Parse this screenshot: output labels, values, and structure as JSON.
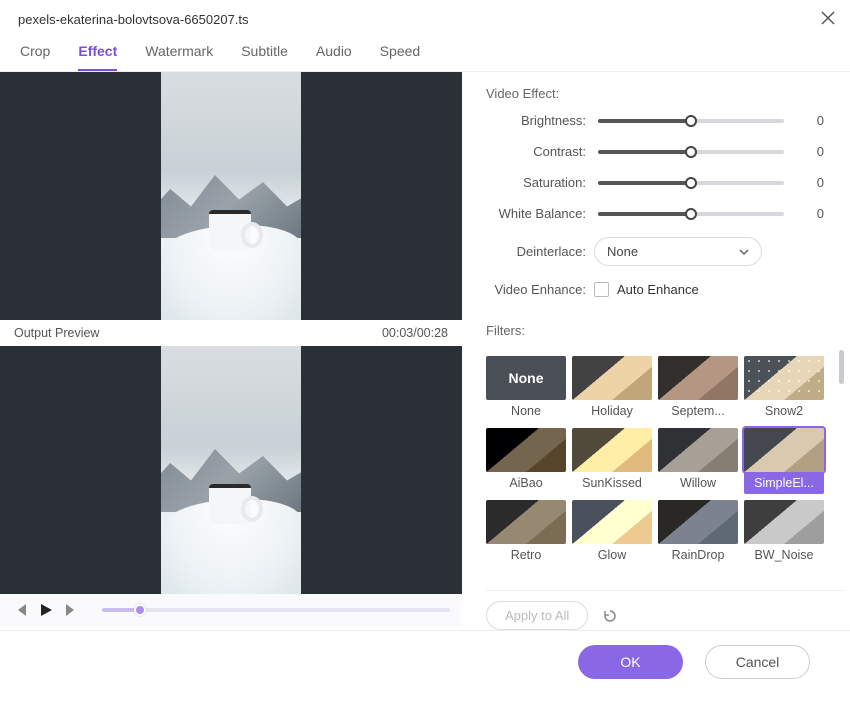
{
  "title": "pexels-ekaterina-bolovtsova-6650207.ts",
  "tabs": [
    "Crop",
    "Effect",
    "Watermark",
    "Subtitle",
    "Audio",
    "Speed"
  ],
  "active_tab": 1,
  "preview": {
    "label": "Output Preview",
    "time": "00:03/00:28",
    "seek_pct": 11
  },
  "video_effect": {
    "title": "Video Effect:",
    "params": [
      {
        "label": "Brightness:",
        "value": "0",
        "pct": 50
      },
      {
        "label": "Contrast:",
        "value": "0",
        "pct": 50
      },
      {
        "label": "Saturation:",
        "value": "0",
        "pct": 50
      },
      {
        "label": "White Balance:",
        "value": "0",
        "pct": 50
      }
    ],
    "deinterlace": {
      "label": "Deinterlace:",
      "selected": "None"
    },
    "enhance": {
      "label": "Video Enhance:",
      "option": "Auto Enhance"
    }
  },
  "filters": {
    "title": "Filters:",
    "items": [
      {
        "label": "None",
        "cls": "none",
        "is_none": true
      },
      {
        "label": "Holiday",
        "cls": "t-holiday"
      },
      {
        "label": "Septem...",
        "cls": "t-septem"
      },
      {
        "label": "Snow2",
        "cls": "t-snow2"
      },
      {
        "label": "AiBao",
        "cls": "t-aibao"
      },
      {
        "label": "SunKissed",
        "cls": "t-sunk"
      },
      {
        "label": "Willow",
        "cls": "t-willow"
      },
      {
        "label": "SimpleEl...",
        "cls": "t-simple",
        "selected": true
      },
      {
        "label": "Retro",
        "cls": "t-retro"
      },
      {
        "label": "Glow",
        "cls": "t-glow"
      },
      {
        "label": "RainDrop",
        "cls": "t-rain"
      },
      {
        "label": "BW_Noise",
        "cls": "t-bw"
      }
    ],
    "apply_all": "Apply to All"
  },
  "footer": {
    "ok": "OK",
    "cancel": "Cancel"
  },
  "none_text": "None"
}
